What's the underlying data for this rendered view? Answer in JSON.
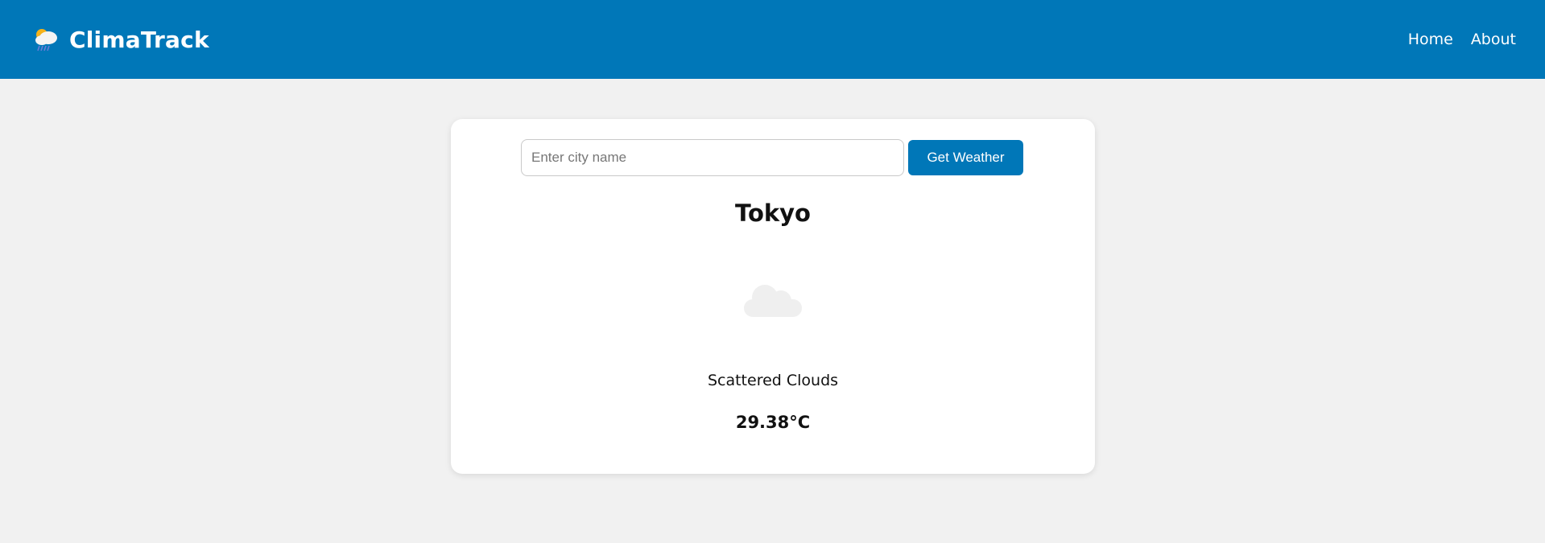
{
  "header": {
    "brand_name": "ClimaTrack",
    "brand_icon": "cloud-rain-sun-icon",
    "nav": [
      {
        "label": "Home"
      },
      {
        "label": "About"
      }
    ],
    "background_color": "#0077b8"
  },
  "search": {
    "placeholder": "Enter city name",
    "value": "",
    "button_label": "Get Weather"
  },
  "weather": {
    "city": "Tokyo",
    "icon": "cloud-icon",
    "description": "Scattered Clouds",
    "temperature": "29.38°C"
  },
  "colors": {
    "accent": "#0077b8",
    "page_background": "#f1f1f1",
    "card_background": "#ffffff"
  }
}
